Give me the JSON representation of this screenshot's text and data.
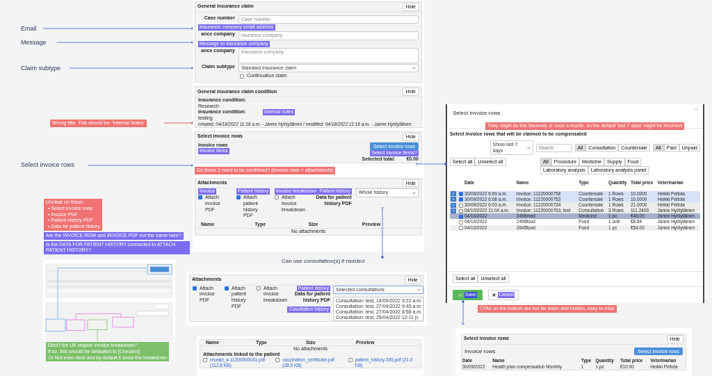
{
  "side_labels": [
    {
      "text": "Email"
    },
    {
      "text": "Message"
    },
    {
      "text": "Claim subtype"
    },
    {
      "text": "Select invoice rows"
    }
  ],
  "wrong_title_note": {
    "text": "Wrong title. This should be: 'Internal Notes'",
    "color": "#f07272"
  },
  "claim_panel": {
    "title": "General insurance claim",
    "hide": "Hide",
    "fields": [
      {
        "kind": "input",
        "label": "Case number",
        "placeholder": "Case number"
      },
      {
        "kind": "input",
        "label": "ance company",
        "placeholder": "nsurance company",
        "tag": "Insurance company email address"
      },
      {
        "kind": "textarea",
        "label": "ance company",
        "placeholder": "Insurance company",
        "tag": "Message to insurance company"
      },
      {
        "kind": "select",
        "label": "Claim subtype",
        "value": "Standard insurance claim"
      }
    ],
    "checkbox": {
      "label": "Continuation claim",
      "checked": false
    }
  },
  "condition_panel": {
    "title": "General insurance claim condition",
    "hide": "Hide",
    "items": [
      {
        "label": "Insurance condition:",
        "value": "Research"
      },
      {
        "label": "Insurance condition:",
        "value": "testing",
        "tag": "Internal notes"
      }
    ],
    "meta": "created: 04/18/2022 11:18 a.m. - Janne Hyötyläinen / modified: 04/18/2022 11:18 a.m. - Janne Hyötyläinen"
  },
  "invoice_panel": {
    "title": "Select invoice rows",
    "hide": "Hide",
    "label": "Invoice rows",
    "label_tag": "Invoice items",
    "button": "Select invoice rows",
    "button_tag": "Select invoice items?",
    "total_label": "Selected total:",
    "total": "€0.00"
  },
  "combine_note": {
    "text": "Do these 2 need to be combined? (invoice rows + attachments)",
    "color": "#f07272"
  },
  "attachments_panel": {
    "title": "Attachments",
    "hide": "Hide",
    "checks": [
      {
        "tag": "Invoice",
        "label": "Attach invoice PDF",
        "checked": true
      },
      {
        "tag": "Patient history",
        "label": "Attach patient history PDF",
        "checked": true
      },
      {
        "tag": "Invoice breakdown",
        "label": "Attach invoice breakdown",
        "checked": false
      }
    ],
    "history_tag": "Patient history",
    "history_label": "Data for patient history PDF",
    "history_select": "Whole history",
    "columns": [
      "Name",
      "Type",
      "Size",
      "Preview"
    ],
    "empty": "No attachments"
  },
  "left_notes": [
    {
      "kind": "list",
      "title": "Unclear on these:",
      "items": [
        "• Select invoice rows",
        "• Invoice PDF",
        "• Patient history PDF",
        "• Data for patient history"
      ],
      "color": "#f07272"
    },
    {
      "kind": "text",
      "text": "Are the INVOICE ROW and INVOICE PDF not the same here?",
      "color": "#7b6cf0"
    },
    {
      "kind": "text",
      "text": "Is the DATA FOR PATIENT HISTORY connected to ATTACH PATIENT HISTORY?",
      "color": "#7b6cf0"
    }
  ],
  "breakdown_note": {
    "lines": [
      "Didn't the UK require invoice breakdown?",
      "If so, this should be defaulted to [Checked]",
      "Or Not even here and by default it show the breakdown"
    ],
    "color": "#7cc06a"
  },
  "consultation_caption": "Can use consultation(s) if needed",
  "attachments_variant": {
    "title": "Attachments",
    "hide": "Hide",
    "checks": [
      {
        "label": "Attach invoice PDF",
        "checked": true
      },
      {
        "label": "Attach patient history PDF",
        "checked": true
      },
      {
        "label": "Attach invoice breakdown",
        "checked": false
      }
    ],
    "history_tag": "Patient history",
    "history_label": "Data for patient history PDF",
    "history_select": "Selected consultations",
    "consult_tag": "Cosultation history",
    "consultations": [
      "Consultation: test, 14/09/2022 9:22 a.m",
      "Consultation: test, 27/04/2022 9:45 a.m",
      "Consultation: test, 27/04/2022 8:58 a.m",
      "Consultation: test, 25/04/2022 12:11 p."
    ]
  },
  "attachments_table": {
    "columns": [
      "Name",
      "Type",
      "Size",
      "Preview"
    ],
    "empty": "No attachments",
    "linked_title": "Attachments linked to the patient",
    "files": [
      {
        "name": "receipt_a-11200000031.pdf (112.8 KB)",
        "checked": false
      },
      {
        "name": "vaccination_certificate.pdf (28.5 KB)",
        "checked": false
      },
      {
        "name": "patient_history-395.pdf (21.0 KB)",
        "checked": false
      }
    ]
  },
  "modal": {
    "title": "Select invoice rows",
    "close": "×",
    "note": {
      "text": "They might do this biweekly or once  a month, so the default 'last 7 days' might be incorrect",
      "color": "#f07272"
    },
    "subtitle": "Select invoice rows that will be claimed to be compensated",
    "period": "Show last 7 days",
    "search_placeholder": "Search",
    "type_filter": [
      {
        "label": "All",
        "selected": true
      },
      {
        "label": "Consultation",
        "selected": false
      },
      {
        "label": "Countersale",
        "selected": false
      }
    ],
    "paid_filter": [
      {
        "label": "All",
        "selected": true
      },
      {
        "label": "Paid",
        "selected": false
      },
      {
        "label": "Unpaid",
        "selected": false
      }
    ],
    "select_buttons": [
      "Select all",
      "Unselect all"
    ],
    "category_filter": [
      {
        "label": "All",
        "selected": true
      },
      {
        "label": "Procedure",
        "selected": false
      },
      {
        "label": "Medicine",
        "selected": false
      },
      {
        "label": "Supply",
        "selected": false
      },
      {
        "label": "Food",
        "selected": false
      },
      {
        "label": "Laboratory analysis",
        "selected": false
      },
      {
        "label": "Laboratory analysis panel",
        "selected": false
      }
    ],
    "columns": [
      "Date",
      "Name",
      "Type",
      "Quantity",
      "Total price",
      "Veterinarian"
    ],
    "rows": [
      {
        "kind": "invoice",
        "expanded": false,
        "checked": true,
        "cells": [
          "30/09/2022 6:09 a.m.",
          "Invoice: 11220000758",
          "Countersale",
          "1 Rows",
          "10.0000",
          "Heikki Peltola"
        ]
      },
      {
        "kind": "invoice",
        "expanded": false,
        "checked": true,
        "cells": [
          "30/09/2022 6:08 a.m.",
          "Invoice: 11220000753",
          "Countersale",
          "1 Rows",
          "10.0000",
          "Heikki Peltola"
        ]
      },
      {
        "kind": "invoice",
        "expanded": false,
        "checked": false,
        "cells": [
          "30/09/2022 6:03 a.m.",
          "Invoice: 11220000734",
          "Countersale",
          "1 Rows",
          "21.0000",
          "Heikki Peltola"
        ]
      },
      {
        "kind": "invoice",
        "expanded": true,
        "checked": false,
        "cells": [
          "04/10/2022 11:04 a.m.",
          "Invoice: 11220000763, test",
          "Consultation",
          "3 Rows",
          "111.2400",
          "Janne Hyötyläinen"
        ]
      },
      {
        "kind": "item",
        "checked": true,
        "cells": [
          "04/10/2022",
          "2496med",
          "Medicine",
          "1 pc",
          "€48.00",
          "Janne Hyötyläinen"
        ]
      },
      {
        "kind": "item",
        "checked": false,
        "cells": [
          "04/10/2022",
          "2496food",
          "Food",
          "1 unit",
          "€8.64",
          "Janne Hyötyläinen"
        ]
      },
      {
        "kind": "item",
        "checked": false,
        "cells": [
          "04/10/2022",
          "2645food",
          "Food",
          "1 pc",
          "€54.00",
          "Janne Hyötyläinen"
        ]
      }
    ],
    "footer_buttons": [
      "Select all",
      "Unselect all"
    ],
    "save": "Save",
    "cancel": "Cancel"
  },
  "cta_note": {
    "text": "CTAs on the bottom are too far down and hidden, easy to miss",
    "color": "#f07272"
  },
  "result_panel": {
    "title": "Select invoice rows",
    "hide": "Hide",
    "label": "Invoice rows",
    "button": "Select invoice rows",
    "columns": [
      "Date",
      "Name",
      "Type",
      "Quantity",
      "Total price",
      "Veterinarian"
    ],
    "row": [
      "30/09/2022",
      "Health plan compensation Monthly",
      "1",
      "1 pc",
      "€10.00",
      "Heikki Peltola"
    ]
  }
}
